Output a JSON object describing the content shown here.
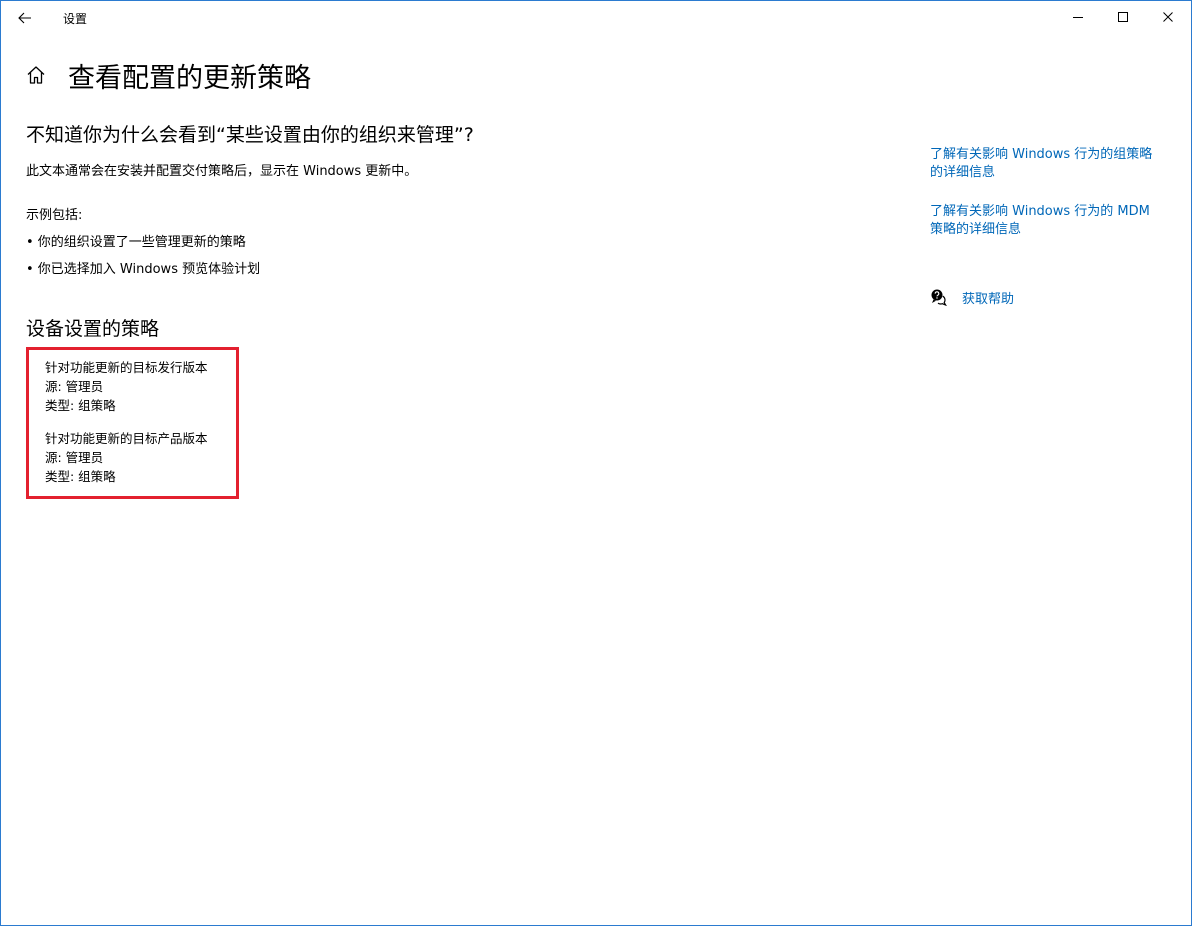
{
  "window": {
    "app_title": "设置",
    "buttons": {
      "back": "back-arrow-icon",
      "minimize": "minimize-icon",
      "maximize": "maximize-icon",
      "close": "close-icon"
    }
  },
  "page": {
    "title": "查看配置的更新策略",
    "home_icon": "home-icon"
  },
  "info": {
    "heading": "不知道你为什么会看到“某些设置由你的组织来管理”?",
    "description": "此文本通常会在安装并配置交付策略后，显示在 Windows 更新中。",
    "examples_label": "示例包括:",
    "examples": [
      "• 你的组织设置了一些管理更新的策略",
      "• 你已选择加入 Windows 预览体验计划"
    ]
  },
  "policies": {
    "heading": "设备设置的策略",
    "items": [
      {
        "name": "针对功能更新的目标发行版本",
        "source": "源: 管理员",
        "type": "类型: 组策略"
      },
      {
        "name": "针对功能更新的目标产品版本",
        "source": "源: 管理员",
        "type": "类型: 组策略"
      }
    ]
  },
  "sidebar": {
    "links": [
      {
        "line1": "了解有关影响 Windows 行为的组策略",
        "line2": "的详细信息"
      },
      {
        "line1": "了解有关影响 Windows 行为的 MDM",
        "line2": "策略的详细信息"
      }
    ],
    "help_label": "获取帮助",
    "help_icon": "chat-help-icon"
  },
  "colors": {
    "link": "#0067b8",
    "highlight_border": "#e3202f",
    "window_border": "#2b7bd0"
  }
}
